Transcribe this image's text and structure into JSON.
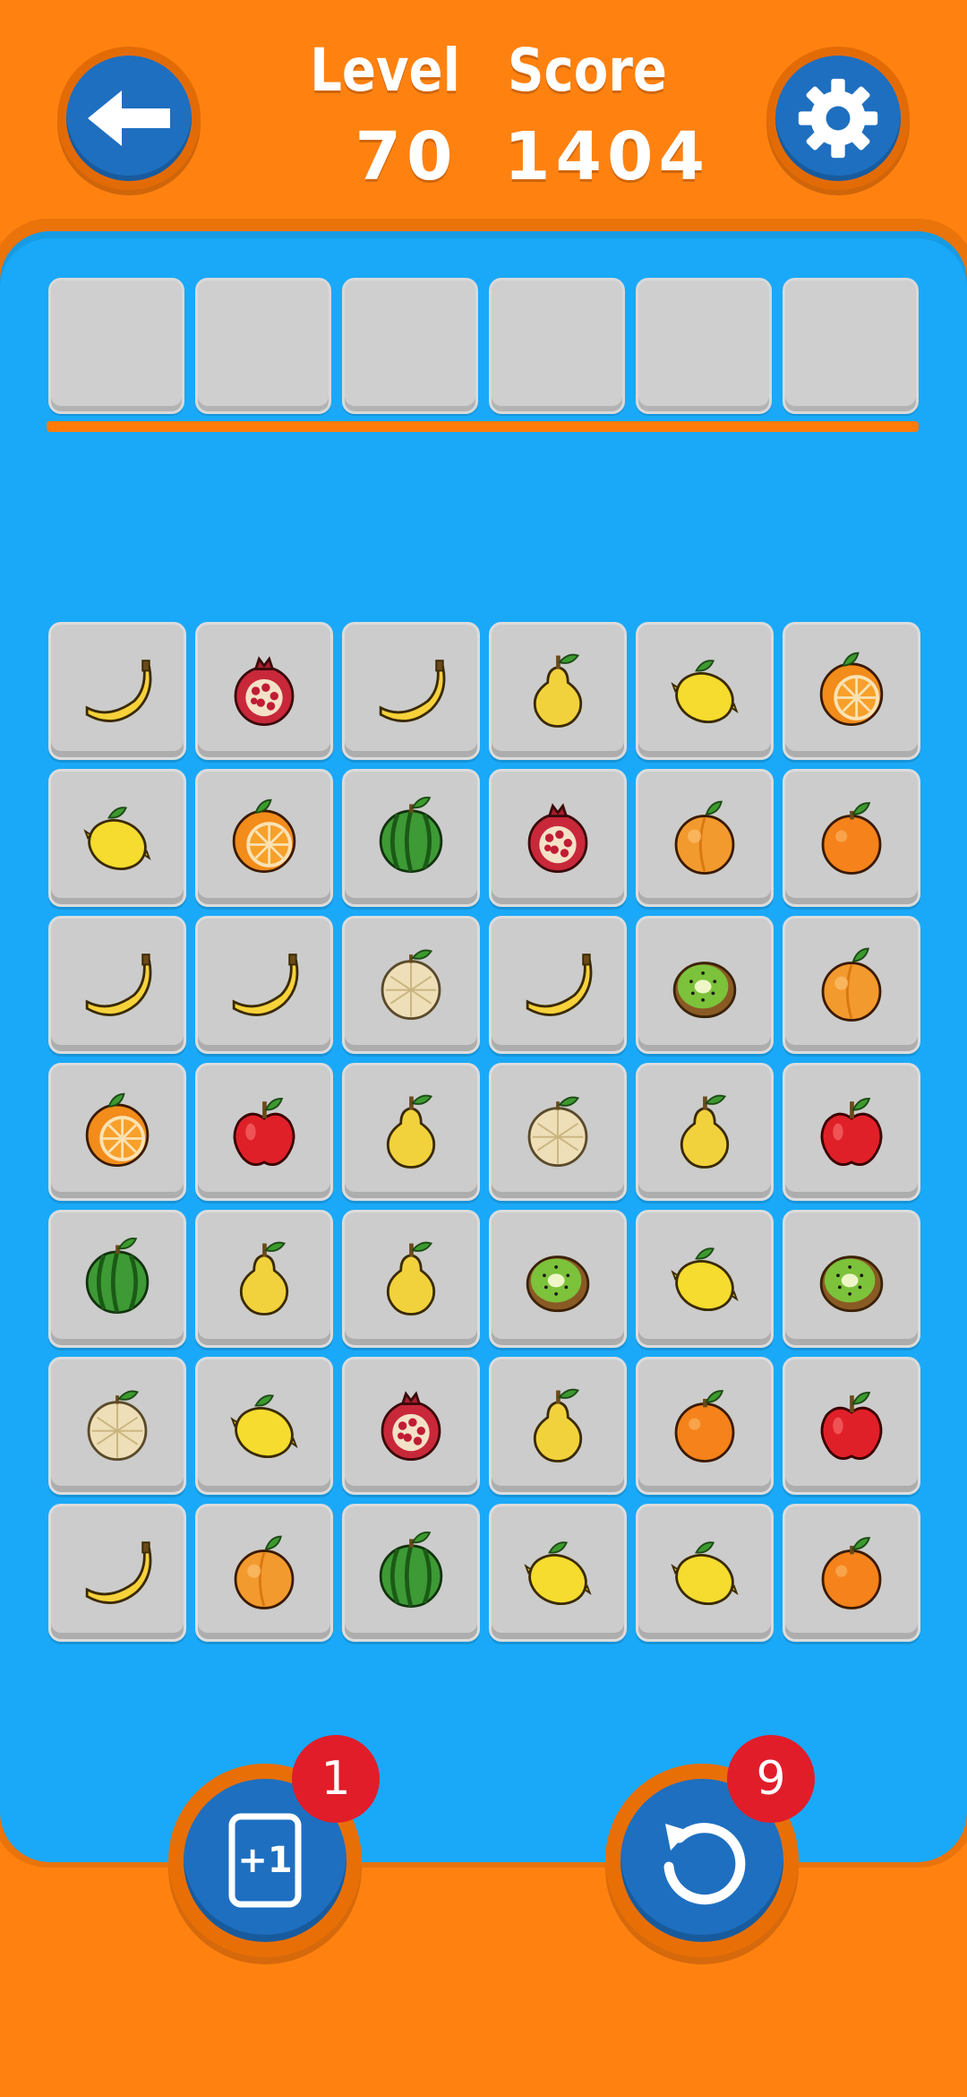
{
  "hud": {
    "level_label": "Level",
    "level_value": "70",
    "score_label": "Score",
    "score_value": "1404"
  },
  "tray": {
    "slots": [
      "",
      "",
      "",
      "",
      "",
      ""
    ]
  },
  "board": {
    "rows": [
      [
        "banana",
        "pomegranate",
        "banana",
        "pear",
        "lemon",
        "orange-half"
      ],
      [
        "lemon",
        "orange-half",
        "watermelon",
        "pomegranate",
        "apricot",
        "orange"
      ],
      [
        "banana",
        "banana",
        "melon",
        "banana",
        "kiwi",
        "apricot"
      ],
      [
        "orange-half",
        "apple",
        "pear",
        "melon",
        "pear",
        "apple"
      ],
      [
        "watermelon",
        "pear",
        "pear",
        "kiwi",
        "lemon",
        "kiwi"
      ],
      [
        "melon",
        "lemon",
        "pomegranate",
        "pear",
        "orange",
        "apple"
      ],
      [
        "banana",
        "apricot",
        "watermelon",
        "lemon",
        "lemon",
        "orange"
      ]
    ]
  },
  "powerups": {
    "plus_one": {
      "icon": "plus-one-card-icon",
      "count": "1"
    },
    "undo": {
      "icon": "undo-icon",
      "count": "9"
    }
  },
  "icons": {
    "back": "arrow-left-icon",
    "settings": "gear-icon"
  },
  "colors": {
    "background": "#ff8210",
    "board": "#1aa9f8",
    "button_blue": "#1e6fc0",
    "badge_red": "#e11d2a",
    "tile_grey": "#cccccc"
  }
}
